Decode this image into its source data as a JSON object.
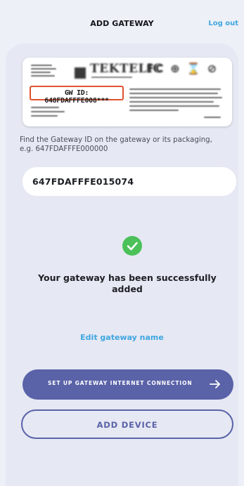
{
  "header": {
    "title": "ADD GATEWAY",
    "logout_label": "Log out"
  },
  "label_image": {
    "brand": "TEKTELIC",
    "gateway_id_label": "GW ID: 648FDAFFFE008***",
    "cert_marks": "FC"
  },
  "instructions": {
    "text": "Find the Gateway ID on the gateway or its packaging, e.g. 647FDAFFFE000000"
  },
  "gateway_id_field": {
    "value": "647FDAFFFE015074"
  },
  "status": {
    "icon": "check-circle-icon",
    "message": "Your gateway has been successfully added",
    "color": "#4cc15a"
  },
  "actions": {
    "edit_name_label": "Edit gateway name",
    "setup_connection_label": "SET UP GATEWAY INTERNET CONNECTION",
    "add_device_label": "ADD DEVICE"
  },
  "colors": {
    "accent": "#5a62a8",
    "link": "#3ea6e0",
    "background": "#eef0f7",
    "highlight": "#e0522f"
  }
}
